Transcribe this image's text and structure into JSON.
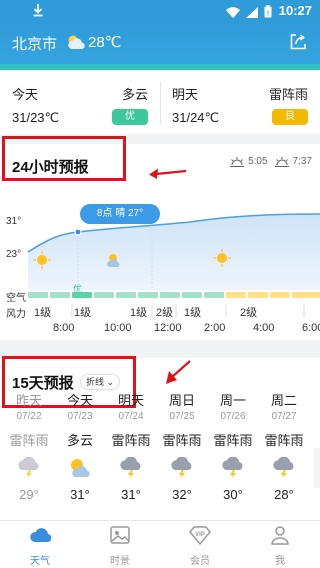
{
  "status": {
    "time": "10:27"
  },
  "header": {
    "city": "北京市",
    "temp": "28℃"
  },
  "today": {
    "name": "今天",
    "cond": "多云",
    "temp": "31/23℃",
    "aqi": "优",
    "aqi_color": "#3cc89a"
  },
  "tomorrow": {
    "name": "明天",
    "cond": "雷阵雨",
    "temp": "31/24℃",
    "aqi": "良",
    "aqi_color": "#f3b800"
  },
  "hourly": {
    "title": "24小时预报",
    "sunrise": "5:05",
    "sunset": "7:37",
    "y_high": "31°",
    "y_low": "23°",
    "air_label": "空气",
    "wind_label": "风力",
    "tooltip": "8点 晴 27°",
    "air_text": "优",
    "winds": [
      "1级",
      "1级",
      "1级",
      "2级",
      "1级",
      "2级"
    ],
    "hours": [
      "8:00",
      "10:00",
      "12:00",
      "2:00",
      "4:00",
      "6:00"
    ]
  },
  "daily": {
    "title": "15天预报",
    "chip": "折线",
    "days": [
      {
        "name": "昨天",
        "date": "07/22",
        "cond": "雷阵雨",
        "temp": "29°",
        "icon": "thunder-icon"
      },
      {
        "name": "今天",
        "date": "07/23",
        "cond": "多云",
        "temp": "31°",
        "icon": "partly-cloudy-icon"
      },
      {
        "name": "明天",
        "date": "07/24",
        "cond": "雷阵雨",
        "temp": "31°",
        "icon": "thunder-icon"
      },
      {
        "name": "周日",
        "date": "07/25",
        "cond": "雷阵雨",
        "temp": "32°",
        "icon": "thunder-icon"
      },
      {
        "name": "周一",
        "date": "07/26",
        "cond": "雷阵雨",
        "temp": "30°",
        "icon": "thunder-icon"
      },
      {
        "name": "周二",
        "date": "07/27",
        "cond": "雷阵雨",
        "temp": "28°",
        "icon": "thunder-icon"
      }
    ]
  },
  "nav": [
    {
      "label": "天气",
      "icon": "weather-icon"
    },
    {
      "label": "时景",
      "icon": "photo-icon"
    },
    {
      "label": "会员",
      "icon": "vip-icon"
    },
    {
      "label": "我",
      "icon": "user-icon"
    }
  ],
  "colors": {
    "brand": "#2f9bd9",
    "accent": "#3b8de0",
    "annotation": "#e0121a"
  }
}
